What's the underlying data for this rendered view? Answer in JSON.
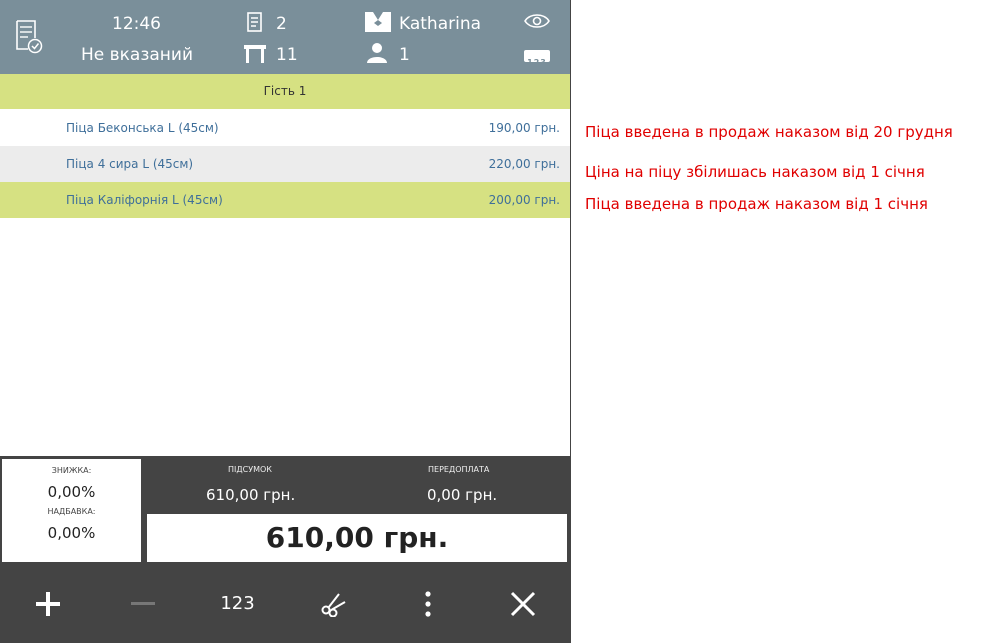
{
  "header": {
    "time": "12:46",
    "order_type": "Не вказаний",
    "receipts_count": "2",
    "table_number": "11",
    "waiter": "Katharina",
    "guests_count": "1",
    "keypad_badge": "123"
  },
  "guest_bar": {
    "label": "Гість 1"
  },
  "order_items": [
    {
      "name": "Піца Беконська L (45см)",
      "price": "190,00 грн."
    },
    {
      "name": "Піца 4 сира L (45см)",
      "price": "220,00 грн."
    },
    {
      "name": "Піца Каліфорнія L (45см)",
      "price": "200,00 грн."
    }
  ],
  "totals": {
    "discount_label": "ЗНИЖКА:",
    "discount_value": "0,00%",
    "markup_label": "НАДБАВКА:",
    "markup_value": "0,00%",
    "subtotal_label": "ПІДСУМОК",
    "subtotal_value": "610,00 грн.",
    "prepayment_label": "ПЕРЕДОПЛАТА",
    "prepayment_value": "0,00 грн.",
    "grand_total": "610,00 грн."
  },
  "toolbar": {
    "numeric_label": "123"
  },
  "annotations": [
    "Піца введена в продаж наказом від 20 грудня",
    "Ціна на піцу збілишась наказом від 1 січня",
    "Піца введена в продаж наказом від 1 січня"
  ],
  "colors": {
    "header_bg": "#7a8f9a",
    "highlight_row": "#d6e182",
    "alt_row": "#ececec",
    "dark_panel": "#444444",
    "annotation_text": "#e00000"
  }
}
